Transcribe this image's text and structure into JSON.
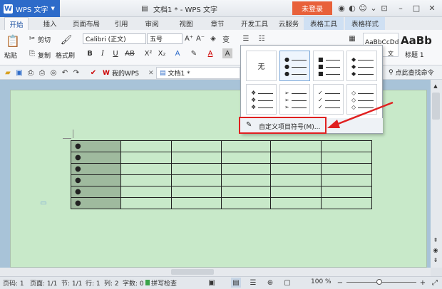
{
  "titlebar": {
    "app_name": "WPS 文字",
    "doc_title": "文档1 * - WPS 文字",
    "login_label": "未登录"
  },
  "tabs": [
    {
      "label": "开始"
    },
    {
      "label": "插入"
    },
    {
      "label": "页面布局"
    },
    {
      "label": "引用"
    },
    {
      "label": "审阅"
    },
    {
      "label": "视图"
    },
    {
      "label": "章节"
    },
    {
      "label": "开发工具"
    },
    {
      "label": "云服务"
    },
    {
      "label": "表格工具"
    },
    {
      "label": "表格样式"
    }
  ],
  "ribbon": {
    "paste": "粘贴",
    "cut": "剪切",
    "copy": "复制",
    "format_painter": "格式刷",
    "font_name": "Calibri (正文)",
    "font_size": "五号",
    "style_preview": "AaBbCcDd",
    "style_big": "AaBb",
    "style_heading": "标题 1",
    "style_sub": "文"
  },
  "quickbar": {
    "tab1": "我的WPS",
    "tab2": "文档1 *",
    "search": "点此查找命令"
  },
  "bullet_menu": {
    "none_label": "无",
    "custom_label": "自定义项目符号(M)..."
  },
  "table": {
    "rows": 6,
    "cols": 6,
    "bullet": "●"
  },
  "statusbar": {
    "page_no": "页码: 1",
    "pages": "页面: 1/1",
    "section": "节: 1/1",
    "row": "行: 1",
    "col": "列: 2",
    "words": "字数: 0",
    "spell": "拼写检查",
    "zoom": "100 %"
  },
  "colors": {
    "accent": "#2d6bc9",
    "login": "#e8613a",
    "page_bg": "#c8e9c9",
    "highlight": "#e02020"
  }
}
